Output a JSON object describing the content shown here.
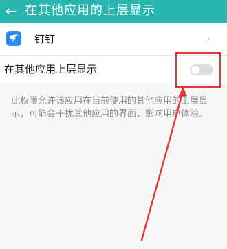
{
  "header": {
    "back_icon": "arrow-left-icon",
    "title": "在其他应用的上层显示"
  },
  "app_row": {
    "name": "钉钉",
    "logo_icon": "dingtalk-icon",
    "logo_color": "#2a8cf0",
    "chevron_icon": "chevron-right-icon"
  },
  "setting": {
    "label": "在其他应用上层显示",
    "toggle_state": "off"
  },
  "description": "此权限允许该应用在当前使用的其他应用的上层显示，可能会干扰其他应用的界面，影响用户体验。",
  "colors": {
    "header_bg": "#29b6b0",
    "annotation": "#e53935",
    "toggle_off": "#dcdcdc"
  }
}
